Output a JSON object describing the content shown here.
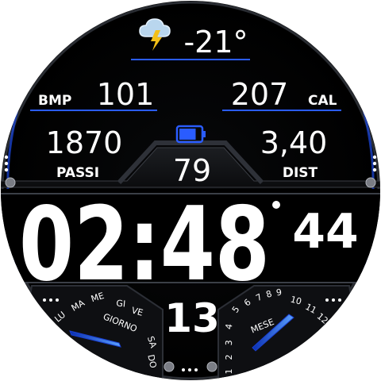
{
  "weather": {
    "icon": "storm-cloud-icon",
    "temperature": "-21°"
  },
  "heart": {
    "label": "BMP",
    "value": "101"
  },
  "calories": {
    "value": "207",
    "label": "CAL"
  },
  "steps": {
    "value": "1870",
    "label": "PASSI"
  },
  "distance": {
    "value": "3,40",
    "label": "DIST"
  },
  "battery": {
    "icon": "battery-icon",
    "value": "79",
    "level": 0.79
  },
  "time": {
    "hours_minutes": "02:48",
    "seconds": "44"
  },
  "day_of_month": "13",
  "weekday_gauge": {
    "title": "GIORNO",
    "days": [
      "LU",
      "MA",
      "ME",
      "GI",
      "VE",
      "SA",
      "DO"
    ]
  },
  "month_gauge": {
    "title": "MESE",
    "months": [
      "1",
      "2",
      "3",
      "4",
      "5",
      "6",
      "7",
      "8",
      "9",
      "10",
      "11",
      "12"
    ]
  },
  "colors": {
    "accent": "#2a5cff",
    "background": "#000000",
    "panel": "#121316",
    "text": "#ffffff",
    "lightning": "#f4c017",
    "cloud": "#b9d6ee"
  }
}
